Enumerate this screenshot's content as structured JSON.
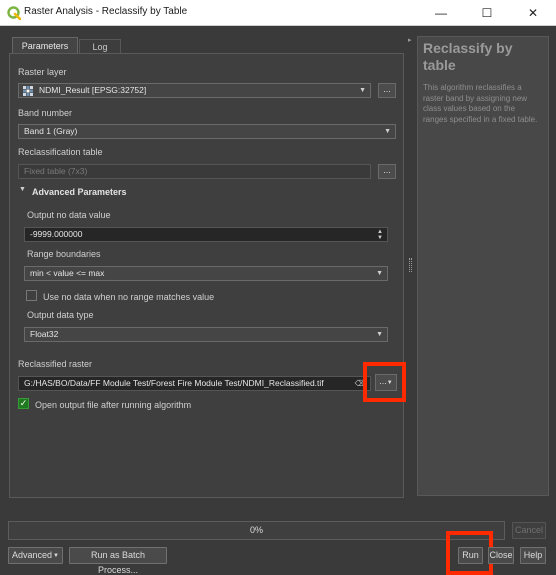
{
  "window": {
    "title": "Raster Analysis - Reclassify by Table",
    "min": "—",
    "max": "☐",
    "close": "✕"
  },
  "tabs": {
    "parameters": "Parameters",
    "log": "Log"
  },
  "params": {
    "raster_layer_label": "Raster layer",
    "raster_layer_value": "NDMI_Result [EPSG:32752]",
    "band_label": "Band number",
    "band_value": "Band 1 (Gray)",
    "table_label": "Reclassification table",
    "table_placeholder": "Fixed table (7x3)",
    "advanced_label": "Advanced Parameters",
    "nodata_label": "Output no data value",
    "nodata_value": "-9999.000000",
    "range_label": "Range boundaries",
    "range_value": "min < value <= max",
    "use_nodata_label": "Use no data when no range matches value",
    "dtype_label": "Output data type",
    "dtype_value": "Float32",
    "reclassified_label": "Reclassified raster",
    "reclassified_value": "G:/HAS/BO/Data/FF Module Test/Forest Fire Module Test/NDMI_Reclassified.tif",
    "open_output_label": "Open output file after running algorithm",
    "dots": "..."
  },
  "help": {
    "title": "Reclassify by table",
    "text": "This algorithm reclassifies a raster band by assigning new class values based on the ranges specified in a fixed table."
  },
  "bottom": {
    "progress": "0%",
    "cancel": "Cancel",
    "advanced": "Advanced",
    "batch": "Run as Batch Process...",
    "run": "Run",
    "close": "Close",
    "help": "Help"
  },
  "icons": [
    "qgis-logo-icon",
    "raster-layer-icon",
    "dropdown-arrow-icon",
    "spinner-icon",
    "clear-icon",
    "splitter-icon",
    "collapse-arrow-icon",
    "checkmark-icon"
  ]
}
